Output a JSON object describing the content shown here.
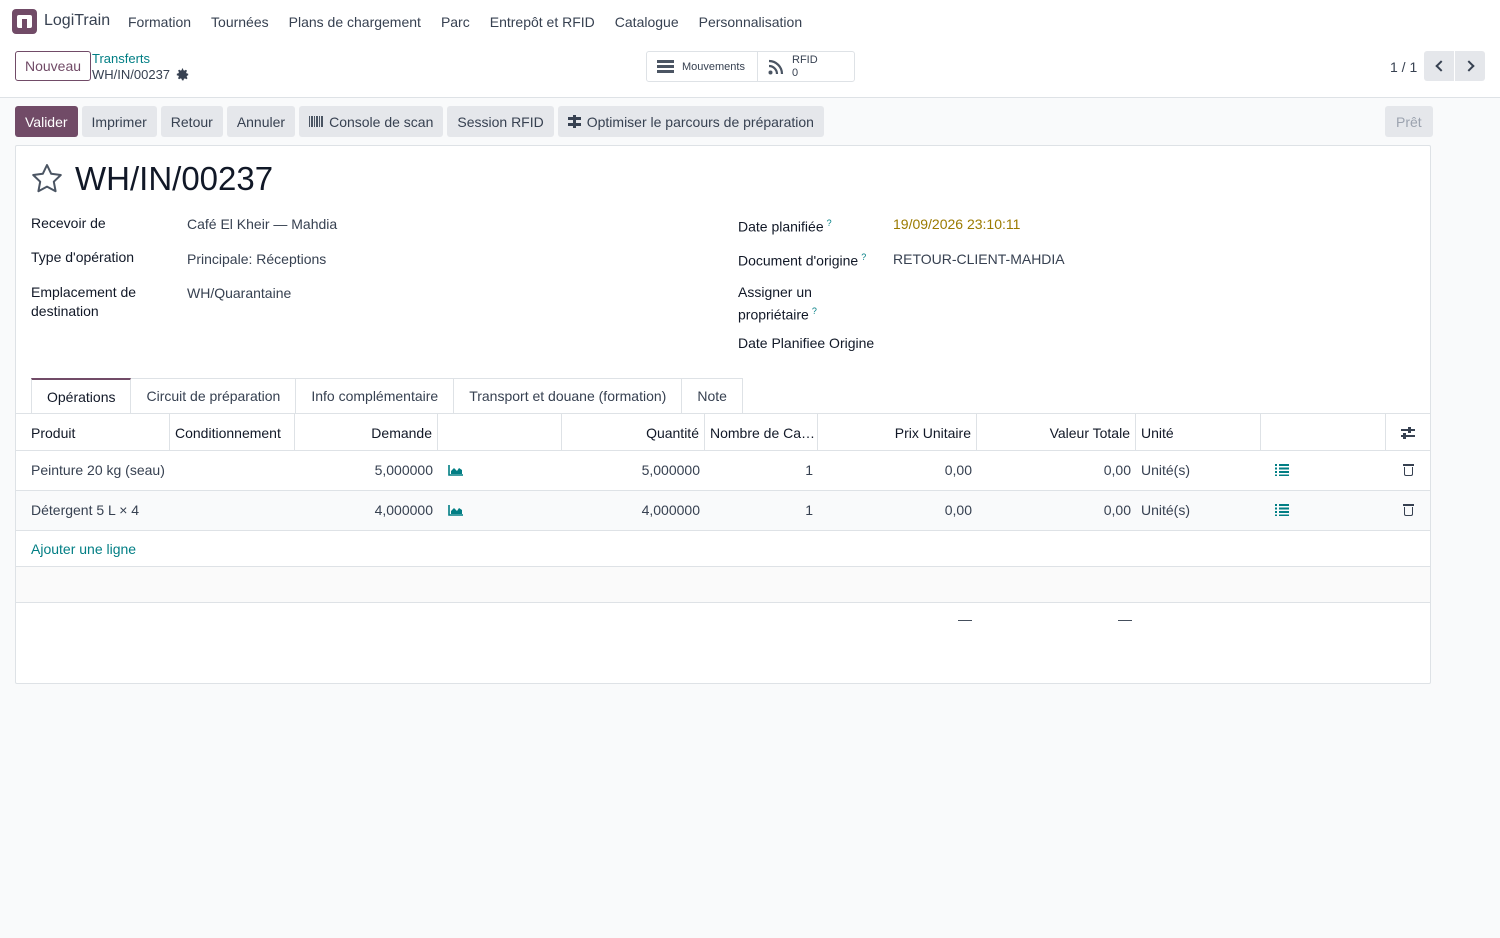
{
  "app": {
    "name": "LogiTrain"
  },
  "menu": [
    "Formation",
    "Tournées",
    "Plans de chargement",
    "Parc",
    "Entrepôt et RFID",
    "Catalogue",
    "Personnalisation"
  ],
  "control": {
    "new_label": "Nouveau",
    "breadcrumb_parent": "Transferts",
    "breadcrumb_current": "WH/IN/00237",
    "stat_moves": "Mouvements",
    "stat_rfid_label": "RFID",
    "stat_rfid_count": "0",
    "pager": "1 / 1"
  },
  "actions": {
    "validate": "Valider",
    "print": "Imprimer",
    "return": "Retour",
    "cancel": "Annuler",
    "scan_console": "Console de scan",
    "rfid_session": "Session RFID",
    "optimize": "Optimiser le parcours de préparation",
    "state": "Prêt"
  },
  "record": {
    "title": "WH/IN/00237",
    "fields_left": [
      {
        "label": "Recevoir de",
        "value": "Café El Kheir — Mahdia"
      },
      {
        "label": "Type d'opération",
        "value": "Principale: Réceptions"
      },
      {
        "label": "Emplacement de destination",
        "value": "WH/Quarantaine"
      }
    ],
    "fields_right": [
      {
        "label": "Date planifiée",
        "value": "19/09/2026 23:10:11"
      },
      {
        "label": "Document d'origine",
        "value": "RETOUR-CLIENT-MAHDIA"
      },
      {
        "label": "Assigner un propriétaire",
        "value": ""
      },
      {
        "label": "Date Planifiee Origine",
        "value": ""
      }
    ],
    "help_mark": "?"
  },
  "tabs": [
    "Opérations",
    "Circuit de préparation",
    "Info complémentaire",
    "Transport et douane (formation)",
    "Note"
  ],
  "table": {
    "headers": [
      "Produit",
      "Conditionnement",
      "Demande",
      "",
      "Quantité",
      "Nombre de Ca…",
      "Prix Unitaire",
      "Valeur Totale",
      "Unité"
    ],
    "rows": [
      {
        "product": "Peinture 20 kg (seau)",
        "packaging": "",
        "demand": "5,000000",
        "quantity": "5,000000",
        "count": "1",
        "unit_price": "0,00",
        "total": "0,00",
        "uom": "Unité(s)"
      },
      {
        "product": "Détergent 5 L × 4",
        "packaging": "",
        "demand": "4,000000",
        "quantity": "4,000000",
        "count": "1",
        "unit_price": "0,00",
        "total": "0,00",
        "uom": "Unité(s)"
      }
    ],
    "add_line": "Ajouter une ligne",
    "sum_unit_price": "—",
    "sum_total": "—"
  },
  "icons": {
    "logo": "app-logo-icon",
    "gear": "gear-icon",
    "moves": "hamburger-icon",
    "rfid": "rss-icon",
    "star": "star-icon",
    "forecast": "chart-area-icon",
    "details": "list-icon",
    "delete": "trash-icon",
    "optional_columns": "sliders-icon"
  },
  "colors": {
    "brand": "#714b67",
    "link": "#017e84",
    "warning_date": "#9b7a00"
  }
}
